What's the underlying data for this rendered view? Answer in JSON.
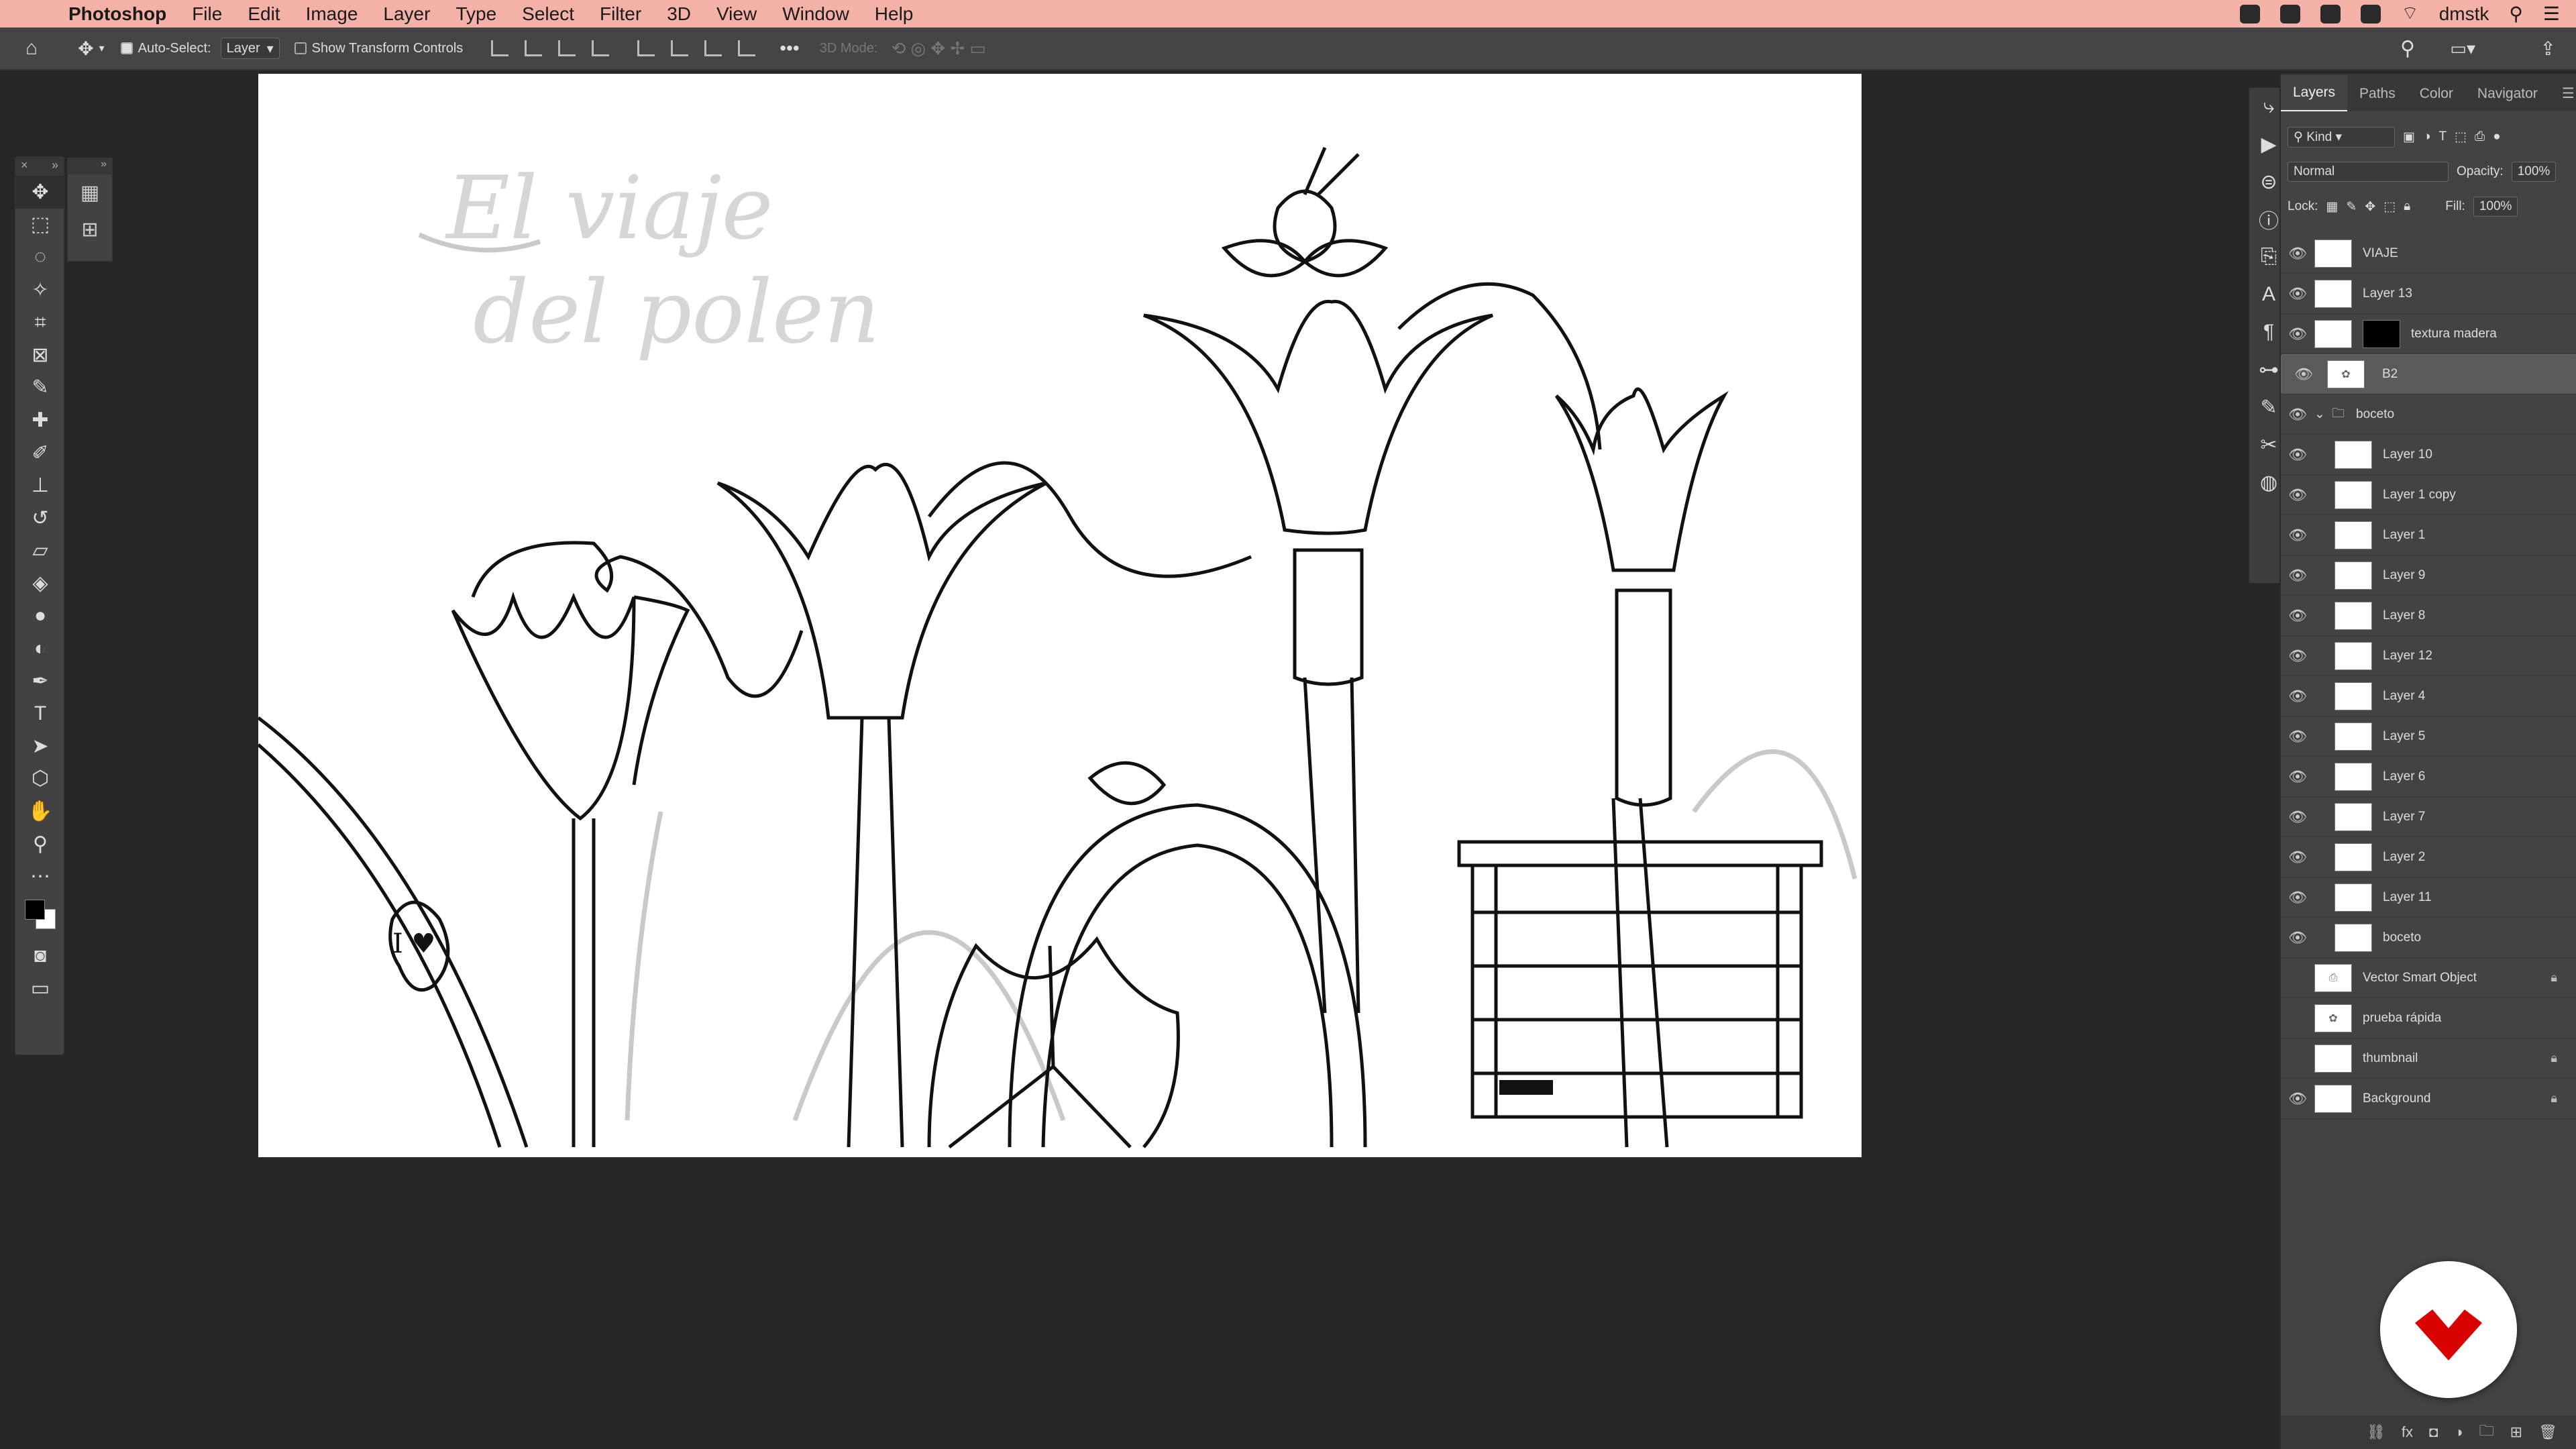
{
  "menubar": {
    "app_name": "Photoshop",
    "items": [
      "File",
      "Edit",
      "Image",
      "Layer",
      "Type",
      "Select",
      "Filter",
      "3D",
      "View",
      "Window",
      "Help"
    ],
    "user": "dmstk"
  },
  "options": {
    "auto_select_label": "Auto-Select:",
    "auto_select_value": "Layer",
    "transform_label": "Show Transform Controls",
    "mode_label": "3D Mode:"
  },
  "canvas": {
    "title_line1": "El viaje",
    "title_line2": "del polen",
    "heart_text": "I ♥"
  },
  "panel": {
    "tabs": [
      "Layers",
      "Paths",
      "Color",
      "Navigator"
    ],
    "filter_value": "Kind",
    "blend_mode": "Normal",
    "opacity_label": "Opacity:",
    "opacity_value": "100%",
    "lock_label": "Lock:",
    "fill_label": "Fill:",
    "fill_value": "100%"
  },
  "layers": [
    {
      "name": "VIAJE",
      "visible": true
    },
    {
      "name": "Layer 13",
      "visible": true
    },
    {
      "name": "textura madera",
      "visible": true,
      "mask": true
    },
    {
      "name": "B2",
      "visible": true,
      "selected": true
    },
    {
      "name": "boceto",
      "visible": true,
      "group": true
    },
    {
      "name": "Layer 10",
      "visible": true,
      "indent": true
    },
    {
      "name": "Layer 1 copy",
      "visible": true,
      "indent": true
    },
    {
      "name": "Layer 1",
      "visible": true,
      "indent": true
    },
    {
      "name": "Layer 9",
      "visible": true,
      "indent": true
    },
    {
      "name": "Layer 8",
      "visible": true,
      "indent": true
    },
    {
      "name": "Layer 12",
      "visible": true,
      "indent": true
    },
    {
      "name": "Layer 4",
      "visible": true,
      "indent": true
    },
    {
      "name": "Layer 5",
      "visible": true,
      "indent": true
    },
    {
      "name": "Layer 6",
      "visible": true,
      "indent": true
    },
    {
      "name": "Layer 7",
      "visible": true,
      "indent": true
    },
    {
      "name": "Layer 2",
      "visible": true,
      "indent": true
    },
    {
      "name": "Layer 11",
      "visible": true,
      "indent": true
    },
    {
      "name": "boceto",
      "visible": true,
      "indent": true
    },
    {
      "name": "Vector Smart Object",
      "visible": false,
      "locked": true
    },
    {
      "name": "prueba rápida",
      "visible": false
    },
    {
      "name": "thumbnail",
      "visible": false,
      "locked": true
    },
    {
      "name": "Background",
      "visible": true,
      "locked": true
    }
  ],
  "colors": {
    "menubar": "#f4b1a8",
    "accent": "#d90000"
  }
}
